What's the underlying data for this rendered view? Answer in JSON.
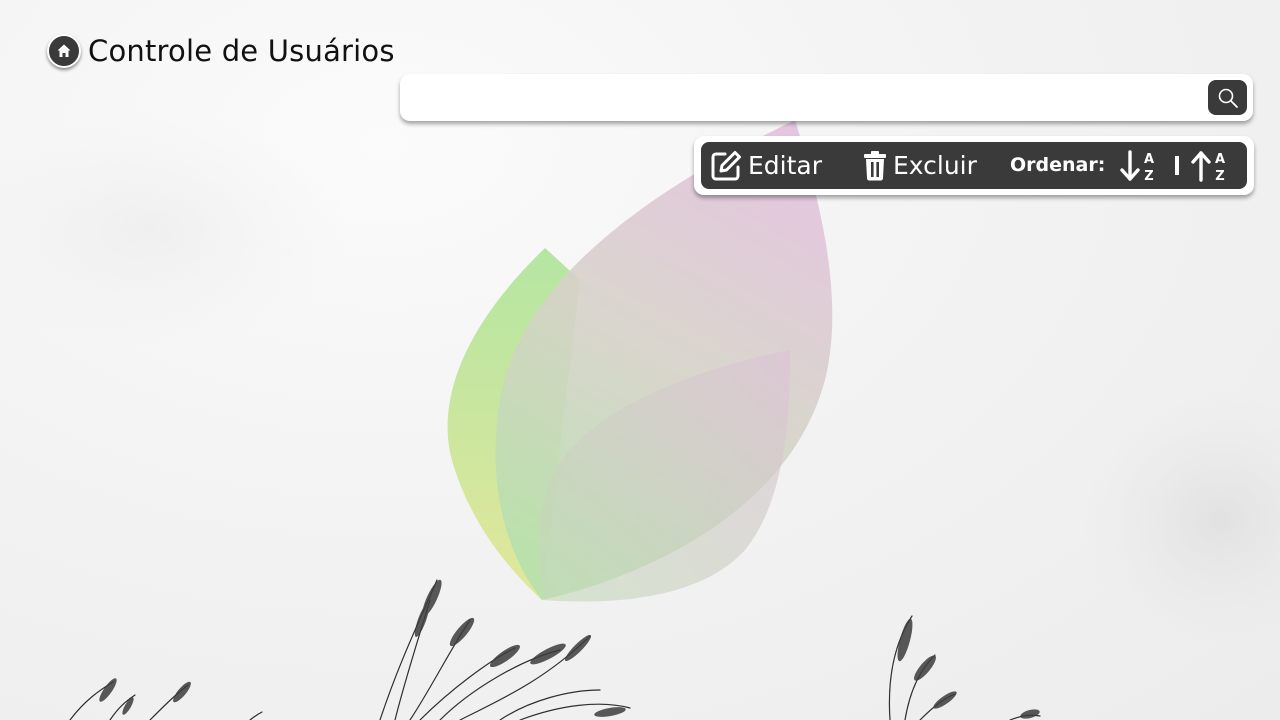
{
  "header": {
    "title": "Controle de Usuários",
    "home_icon": "home-icon"
  },
  "search": {
    "value": "",
    "placeholder": "",
    "button_icon": "search-icon"
  },
  "toolbar": {
    "edit_label": "Editar",
    "edit_icon": "edit-icon",
    "delete_label": "Excluir",
    "delete_icon": "trash-icon",
    "sort_label": "Ordenar:",
    "sort_desc_icon": "sort-down-a-z-icon",
    "sort_asc_icon": "sort-up-a-z-icon"
  },
  "colors": {
    "dark": "#3a3a3a",
    "surface": "#ffffff",
    "leaf_green": "#b8e6a0",
    "leaf_pink": "#e2c4dc",
    "background": "#f2f2f2"
  }
}
